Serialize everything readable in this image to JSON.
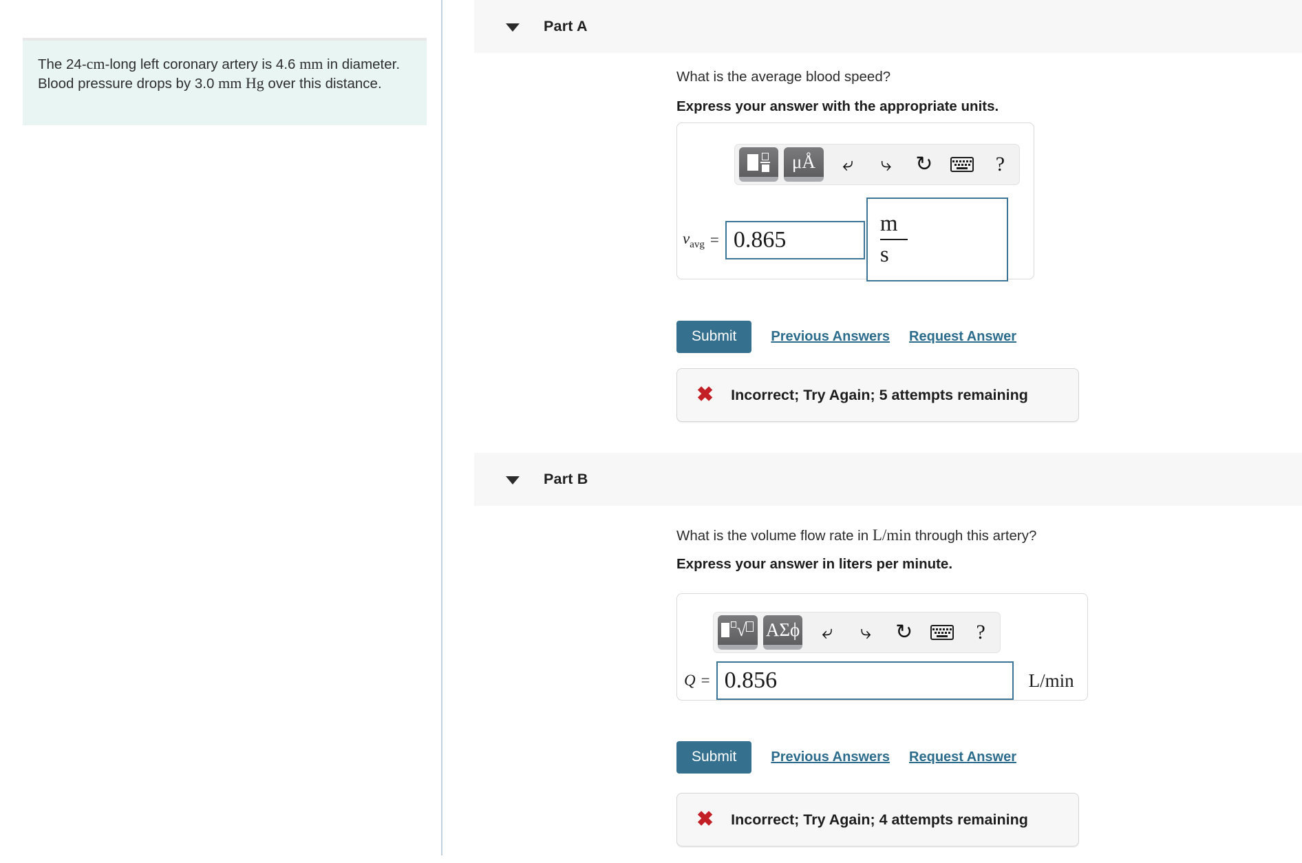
{
  "problem": {
    "statement_plain_1": "The 24-",
    "statement_unit_cm": "cm",
    "statement_plain_2": "-long left coronary artery is 4.6 ",
    "statement_unit_mm": "mm",
    "statement_plain_3": " in diameter. Blood pressure drops by 3.0 ",
    "statement_unit_mmhg": "mm Hg",
    "statement_plain_4": " over this distance.",
    "full_text": "The 24-cm -long left coronary artery is 4.6 mm in diameter. Blood pressure drops by 3.0 mm Hg over this distance."
  },
  "colors": {
    "accent_blue": "#35708f",
    "link_blue": "#2b6c8c",
    "input_border": "#3a7595",
    "info_bg": "#e8f5f3",
    "band_bg": "#f7f7f8",
    "error_red": "#c22026",
    "divider": "#c3d0e0"
  },
  "toolbar_common": {
    "undo": "undo-arrow",
    "redo": "redo-arrow",
    "reset": "reset-circular-arrow",
    "keyboard": "keyboard",
    "help": "?"
  },
  "parts": [
    {
      "id": "A",
      "header_label": "Part A",
      "question": "What is the average blood speed?",
      "instruction": "Express your answer with the appropriate units.",
      "toolbar": {
        "template_icon": "math-template-icon",
        "symbol_icon_label": "μÅ",
        "symbol_icon_name": "units-symbol-icon"
      },
      "answer": {
        "variable": "v",
        "variable_sub": "avg",
        "equals": "=",
        "value": "0.865",
        "unit_numerator": "m",
        "unit_denominator": "s",
        "unit_display": "m/s"
      },
      "submit_label": "Submit",
      "previous_answers_label": "Previous Answers",
      "request_answer_label": "Request Answer",
      "feedback": {
        "icon": "✖",
        "text": "Incorrect; Try Again; 5 attempts remaining",
        "attempts_remaining": 5
      }
    },
    {
      "id": "B",
      "header_label": "Part B",
      "question_prefix": "What is the volume flow rate in ",
      "question_unit": "L/min",
      "question_suffix": " through this artery?",
      "question_full": "What is the volume flow rate in L/min through this artery?",
      "instruction": "Express your answer in liters per minute.",
      "toolbar": {
        "template_icon": "radical-template-icon",
        "symbol_icon_label": "ΑΣϕ",
        "symbol_icon_name": "greek-symbol-icon"
      },
      "answer": {
        "variable": "Q",
        "equals": "=",
        "value": "0.856",
        "unit_display": "L/min"
      },
      "submit_label": "Submit",
      "previous_answers_label": "Previous Answers",
      "request_answer_label": "Request Answer",
      "feedback": {
        "icon": "✖",
        "text": "Incorrect; Try Again; 4 attempts remaining",
        "attempts_remaining": 4
      }
    }
  ]
}
